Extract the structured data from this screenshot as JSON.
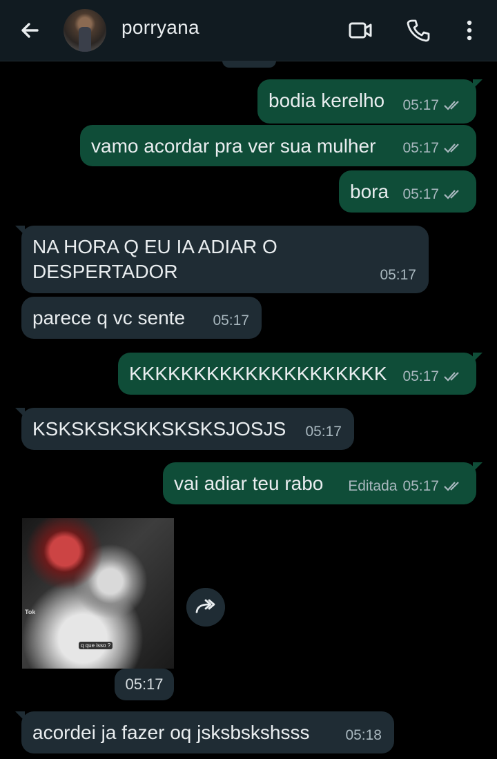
{
  "header": {
    "contact_name": "porryana",
    "icons": {
      "back": "arrow-left-icon",
      "video": "video-call-icon",
      "call": "phone-call-icon",
      "menu": "more-vertical-icon"
    }
  },
  "messages": [
    {
      "direction": "outgoing",
      "text": "bodia kerelho",
      "time": "05:17",
      "status": "read-double-check"
    },
    {
      "direction": "outgoing",
      "text": "vamo acordar pra ver sua mulher",
      "time": "05:17",
      "status": "read-double-check"
    },
    {
      "direction": "outgoing",
      "text": "bora",
      "time": "05:17",
      "status": "read-double-check"
    },
    {
      "direction": "incoming",
      "lines": [
        "NA HORA Q EU IA ADIAR O",
        "DESPERTADOR"
      ],
      "time": "05:17"
    },
    {
      "direction": "incoming",
      "text": "parece q vc sente",
      "time": "05:17"
    },
    {
      "direction": "outgoing",
      "text": "KKKKKKKKKKKKKKKKKKKK",
      "time": "05:17",
      "status": "read-double-check"
    },
    {
      "direction": "incoming",
      "text": "KSKSKSKSKKSKSKSJOSJS",
      "time": "05:17"
    },
    {
      "direction": "outgoing",
      "text": "vai adiar teu rabo",
      "edited_label": "Editada",
      "time": "05:17",
      "status": "read-double-check"
    },
    {
      "direction": "incoming",
      "type": "media",
      "overlay_label": "Tok",
      "caption": "q que isso ?",
      "time": "05:17",
      "forward_icon": "forward-icon"
    },
    {
      "direction": "incoming",
      "text": "acordei ja fazer oq jsksbskshsss",
      "time": "05:18"
    }
  ],
  "colors": {
    "background": "#000000",
    "header": "#111b21",
    "outgoing_bubble": "#0f4d38",
    "incoming_bubble": "#1f2c34",
    "text": "#e9edef",
    "meta_text": "#a9b8bf"
  }
}
